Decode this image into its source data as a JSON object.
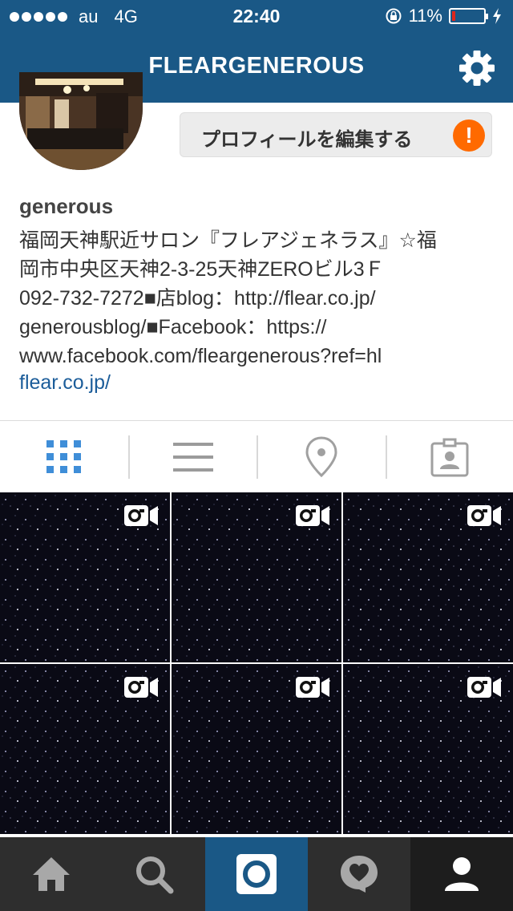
{
  "status_bar": {
    "carrier": "au",
    "network": "4G",
    "time": "22:40",
    "battery_percent": "11%",
    "battery_level": 0.11
  },
  "header": {
    "title": "FLEARGENEROUS"
  },
  "profile": {
    "edit_button_label": "プロフィールを編集する",
    "warning_badge": "!",
    "username": "generous",
    "bio": "福岡天神駅近サロン『フレアジェネラス』☆福\n岡市中央区天神2-3-25天神ZEROビル3Ｆ\n092-732-7272■店blog：http://flear.co.jp/\ngenerousblog/■Facebook：https://\nwww.facebook.com/fleargenerous?ref=hl",
    "link": "flear.co.jp/"
  },
  "tabs": [
    {
      "name": "grid-view",
      "icon": "grid-icon",
      "active": true
    },
    {
      "name": "list-view",
      "icon": "list-icon",
      "active": false
    },
    {
      "name": "map-view",
      "icon": "location-pin-icon",
      "active": false
    },
    {
      "name": "tagged-view",
      "icon": "tagged-person-icon",
      "active": false
    }
  ],
  "posts": [
    {
      "type": "video"
    },
    {
      "type": "video"
    },
    {
      "type": "video"
    },
    {
      "type": "video"
    },
    {
      "type": "video"
    },
    {
      "type": "video"
    }
  ],
  "bottom_nav": [
    {
      "name": "home",
      "icon": "home-icon"
    },
    {
      "name": "explore",
      "icon": "search-icon"
    },
    {
      "name": "camera",
      "icon": "camera-icon",
      "active": true
    },
    {
      "name": "activity",
      "icon": "heart-bubble-icon"
    },
    {
      "name": "profile",
      "icon": "person-icon"
    }
  ],
  "colors": {
    "brand_blue": "#1a5886",
    "link_blue": "#1c5d9a",
    "warning_orange": "#ff6a00",
    "tab_active_blue": "#3f8ed8"
  }
}
